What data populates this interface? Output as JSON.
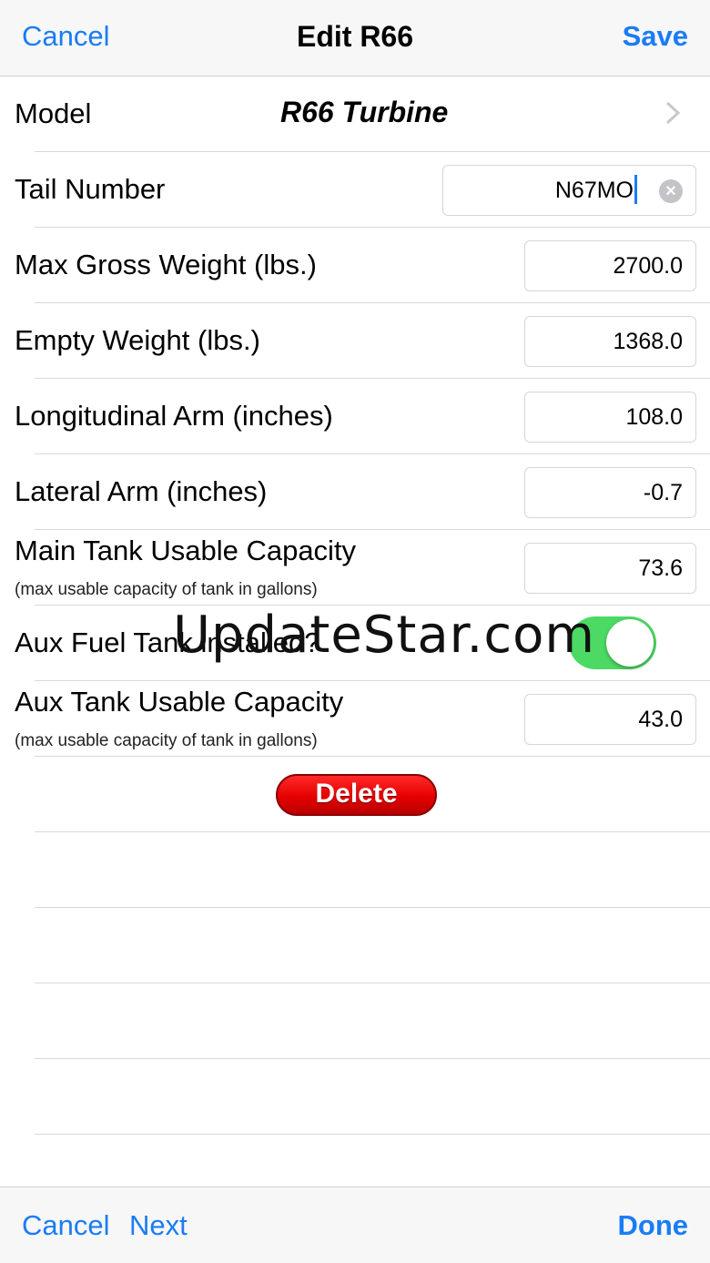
{
  "navbar": {
    "cancel": "Cancel",
    "title": "Edit R66",
    "save": "Save"
  },
  "form": {
    "model": {
      "label": "Model",
      "value": "R66 Turbine"
    },
    "tail_number": {
      "label": "Tail Number",
      "value": "N67MO"
    },
    "max_gross_weight": {
      "label": "Max Gross Weight (lbs.)",
      "value": "2700.0"
    },
    "empty_weight": {
      "label": "Empty Weight (lbs.)",
      "value": "1368.0"
    },
    "longitudinal_arm": {
      "label": "Longitudinal Arm (inches)",
      "value": "108.0"
    },
    "lateral_arm": {
      "label": "Lateral Arm (inches)",
      "value": "-0.7"
    },
    "main_tank": {
      "label": "Main Tank Usable Capacity",
      "sublabel": "(max usable capacity of tank in gallons)",
      "value": "73.6"
    },
    "aux_installed": {
      "label": "Aux Fuel Tank installed?",
      "on": true
    },
    "aux_tank": {
      "label": "Aux Tank Usable Capacity",
      "sublabel": "(max usable capacity of tank in gallons)",
      "value": "43.0"
    },
    "delete": "Delete"
  },
  "watermark": "UpdateStar.com",
  "toolbar": {
    "cancel": "Cancel",
    "next": "Next",
    "done": "Done"
  },
  "colors": {
    "accent": "#1a7cf5",
    "toggle_on": "#4cd964",
    "delete": "#e60000"
  }
}
